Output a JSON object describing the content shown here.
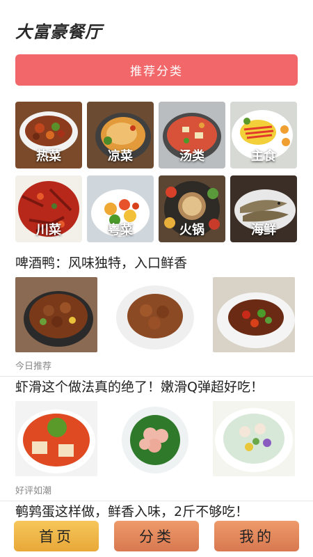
{
  "header": {
    "title": "大富豪餐厅"
  },
  "category_banner": {
    "label": "推荐分类"
  },
  "categories": [
    {
      "label": "热菜",
      "icon": "hot-dish-photo"
    },
    {
      "label": "凉菜",
      "icon": "cold-dish-photo"
    },
    {
      "label": "汤类",
      "icon": "soup-photo"
    },
    {
      "label": "主食",
      "icon": "staple-food-photo"
    },
    {
      "label": "川菜",
      "icon": "sichuan-dish-photo"
    },
    {
      "label": "粤菜",
      "icon": "cantonese-dish-photo"
    },
    {
      "label": "火锅",
      "icon": "hotpot-photo"
    },
    {
      "label": "海鲜",
      "icon": "seafood-photo"
    }
  ],
  "recipes": [
    {
      "title": "啤酒鸭：风味独特，入口鲜香",
      "tag": "今日推荐"
    },
    {
      "title": "虾滑这个做法真的绝了！嫩滑Q弹超好吃！",
      "tag": "好评如潮"
    },
    {
      "title": "鹌鹑蛋这样做，鲜香入味，2斤不够吃！",
      "tag": ""
    }
  ],
  "nav": {
    "home": "首页",
    "category": "分类",
    "mine": "我的"
  },
  "colors": {
    "banner": "#f2686a",
    "nav_home": "#f0b94a",
    "nav_other": "#e0885c"
  }
}
